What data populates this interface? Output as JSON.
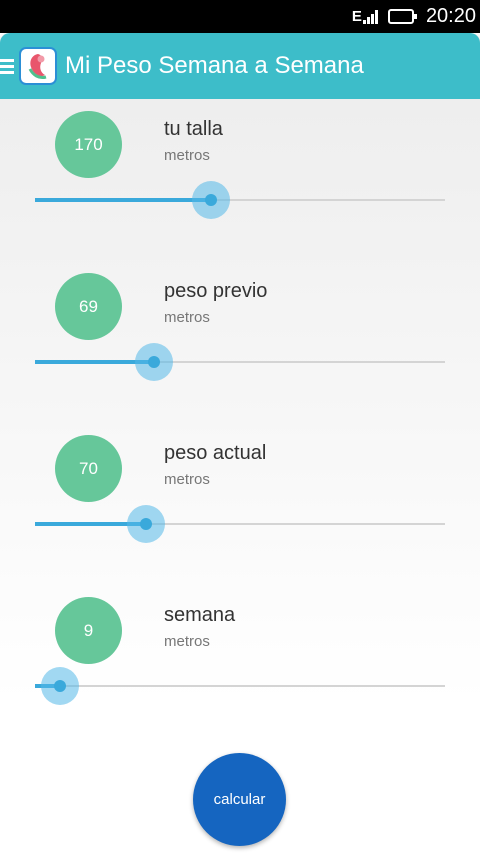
{
  "status_bar": {
    "network": "E",
    "time": "20:20",
    "battery_level": 1.0,
    "signal_icon": "signal-icon",
    "battery_icon": "battery-icon"
  },
  "app_bar": {
    "title": "Mi Peso Semana a Semana",
    "menu_icon": "menu-icon",
    "logo_icon": "app-logo-icon",
    "color": "#3dbdc9"
  },
  "fields": [
    {
      "value": "170",
      "label": "tu talla",
      "unit": "metros",
      "slider_fraction": 0.43
    },
    {
      "value": "69",
      "label": "peso previo",
      "unit": "metros",
      "slider_fraction": 0.29
    },
    {
      "value": "70",
      "label": "peso actual",
      "unit": "metros",
      "slider_fraction": 0.27
    },
    {
      "value": "9",
      "label": "semana",
      "unit": "metros",
      "slider_fraction": 0.06
    }
  ],
  "calculate_button": {
    "label": "calcular"
  },
  "colors": {
    "value_circle": "#66c79a",
    "slider": "#3aa9db",
    "button": "#1565c0"
  }
}
